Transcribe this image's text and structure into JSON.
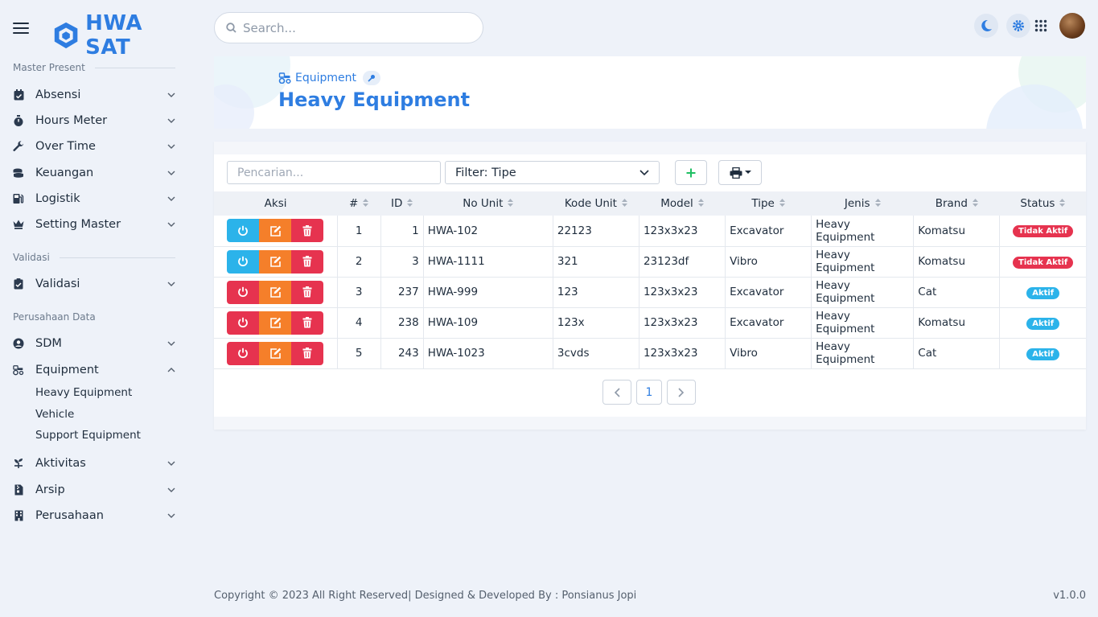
{
  "app": {
    "name": "HWA SAT"
  },
  "search": {
    "placeholder": "Search..."
  },
  "sidebar": {
    "sections": [
      {
        "title": "Master Present"
      },
      {
        "title": "Validasi"
      },
      {
        "title": "Perusahaan Data"
      }
    ],
    "items": [
      {
        "label": "Absensi",
        "icon": "calendar-check-icon"
      },
      {
        "label": "Hours Meter",
        "icon": "stopwatch-icon"
      },
      {
        "label": "Over Time",
        "icon": "wrench-icon"
      },
      {
        "label": "Keuangan",
        "icon": "coins-icon"
      },
      {
        "label": "Logistik",
        "icon": "gas-pump-icon"
      },
      {
        "label": "Setting Master",
        "icon": "crown-icon"
      },
      {
        "label": "Validasi",
        "icon": "clipboard-check-icon"
      },
      {
        "label": "SDM",
        "icon": "user-circle-icon"
      },
      {
        "label": "Equipment",
        "icon": "tractor-icon"
      },
      {
        "label": "Aktivitas",
        "icon": "seedling-icon"
      },
      {
        "label": "Arsip",
        "icon": "file-archive-icon"
      },
      {
        "label": "Perusahaan",
        "icon": "building-icon"
      }
    ],
    "equipment_sub": [
      {
        "label": "Heavy Equipment"
      },
      {
        "label": "Vehicle"
      },
      {
        "label": "Support Equipment"
      }
    ]
  },
  "header": {
    "breadcrumb": "Equipment",
    "title": "Heavy Equipment"
  },
  "filters": {
    "search_placeholder": "Pencarian...",
    "type_filter": "Filter: Tipe"
  },
  "table": {
    "columns": [
      "Aksi",
      "#",
      "ID",
      "No Unit",
      "Kode Unit",
      "Model",
      "Tipe",
      "Jenis",
      "Brand",
      "Status"
    ],
    "rows": [
      {
        "num": "1",
        "id": "1",
        "no_unit": "HWA-102",
        "kode_unit": "22123",
        "model": "123x3x23",
        "tipe": "Excavator",
        "jenis": "Heavy Equipment",
        "brand": "Komatsu",
        "status": "Tidak Aktif",
        "active": false
      },
      {
        "num": "2",
        "id": "3",
        "no_unit": "HWA-1111",
        "kode_unit": "321",
        "model": "23123df",
        "tipe": "Vibro",
        "jenis": "Heavy Equipment",
        "brand": "Komatsu",
        "status": "Tidak Aktif",
        "active": false
      },
      {
        "num": "3",
        "id": "237",
        "no_unit": "HWA-999",
        "kode_unit": "123",
        "model": "123x3x23",
        "tipe": "Excavator",
        "jenis": "Heavy Equipment",
        "brand": "Cat",
        "status": "Aktif",
        "active": true
      },
      {
        "num": "4",
        "id": "238",
        "no_unit": "HWA-109",
        "kode_unit": "123x",
        "model": "123x3x23",
        "tipe": "Excavator",
        "jenis": "Heavy Equipment",
        "brand": "Komatsu",
        "status": "Aktif",
        "active": true
      },
      {
        "num": "5",
        "id": "243",
        "no_unit": "HWA-1023",
        "kode_unit": "3cvds",
        "model": "123x3x23",
        "tipe": "Vibro",
        "jenis": "Heavy Equipment",
        "brand": "Cat",
        "status": "Aktif",
        "active": true
      }
    ]
  },
  "pagination": {
    "current": "1"
  },
  "footer": {
    "copyright": "Copyright © 2023 All Right Reserved| Designed & Developed By : Ponsianus Jopi",
    "version": "v1.0.0"
  },
  "colors": {
    "primary": "#2e7de1",
    "danger": "#e6334f",
    "info": "#2bb3ea",
    "warning": "#f57f2a",
    "success": "#1fbf63",
    "background": "#eef2f9"
  }
}
